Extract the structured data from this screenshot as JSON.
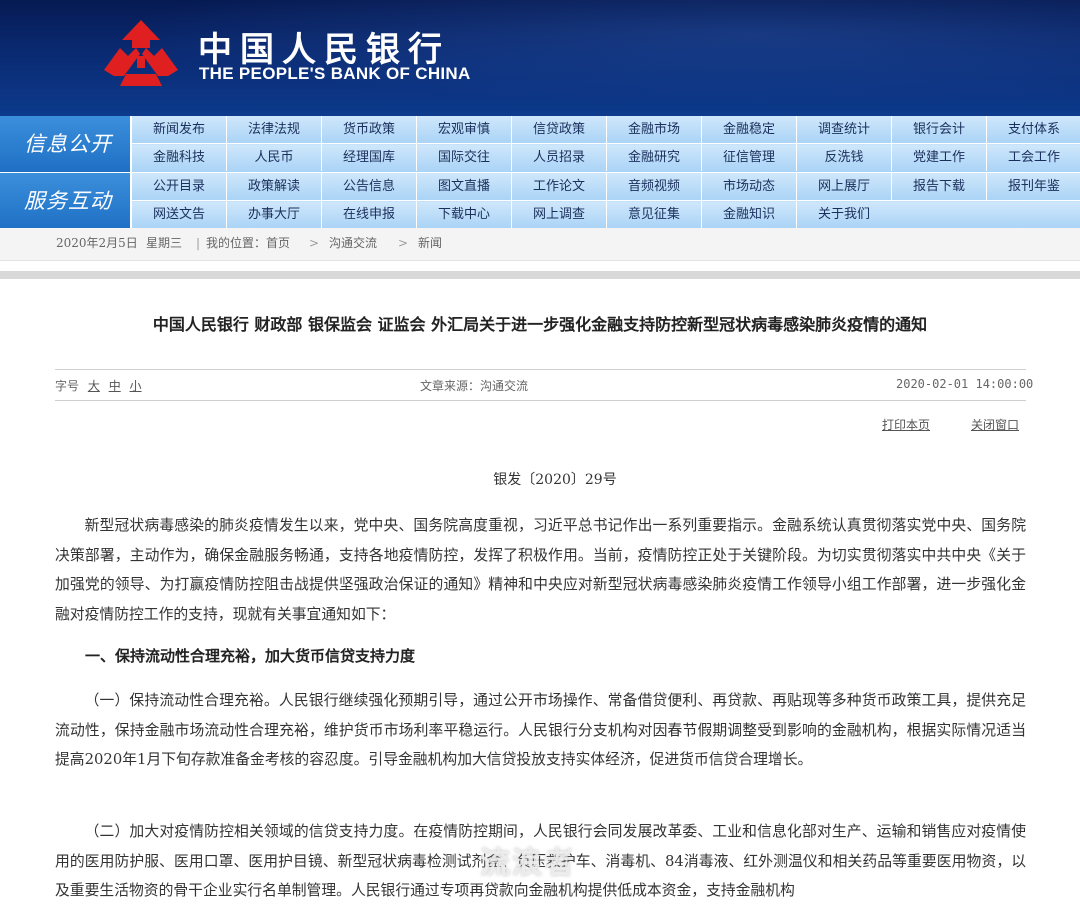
{
  "header": {
    "logo_cn": "中国人民银行",
    "logo_en": "THE PEOPLE'S BANK OF CHINA",
    "accent": "#0a2a72",
    "emblem_color": "#e02020"
  },
  "nav": {
    "section1_title": "信息公开",
    "section2_title": "服务互动",
    "row1_top": [
      "新闻发布",
      "法律法规",
      "货币政策",
      "宏观审慎",
      "信贷政策",
      "金融市场",
      "金融稳定",
      "调查统计",
      "银行会计",
      "支付体系"
    ],
    "row1_bottom": [
      "金融科技",
      "人民币",
      "经理国库",
      "国际交往",
      "人员招录",
      "金融研究",
      "征信管理",
      "反洗钱",
      "党建工作",
      "工会工作"
    ],
    "row2_top": [
      "公开目录",
      "政策解读",
      "公告信息",
      "图文直播",
      "工作论文",
      "音频视频",
      "市场动态",
      "网上展厅",
      "报告下载",
      "报刊年鉴"
    ],
    "row2_bottom": [
      "网送文告",
      "办事大厅",
      "在线申报",
      "下载中心",
      "网上调查",
      "意见征集",
      "金融知识",
      "关于我们"
    ]
  },
  "breadcrumb": {
    "date": "2020年2月5日",
    "weekday": "星期三",
    "location_label": "我的位置：首页",
    "sep": ">",
    "level1": "沟通交流",
    "level2": "新闻"
  },
  "article": {
    "title": "中国人民银行 财政部 银保监会 证监会 外汇局关于进一步强化金融支持防控新型冠状病毒感染肺炎疫情的通知",
    "font_size_label": "字号",
    "font_large": "大",
    "font_medium": "中",
    "font_small": "小",
    "source": "文章来源：沟通交流",
    "published": "2020-02-01 14:00:00",
    "print_label": "打印本页",
    "close_label": "关闭窗口",
    "doc_number": "银发〔2020〕29号",
    "para1": "新型冠状病毒感染的肺炎疫情发生以来，党中央、国务院高度重视，习近平总书记作出一系列重要指示。金融系统认真贯彻落实党中央、国务院决策部署，主动作为，确保金融服务畅通，支持各地疫情防控，发挥了积极作用。当前，疫情防控正处于关键阶段。为切实贯彻落实中共中央《关于加强党的领导、为打赢疫情防控阻击战提供坚强政治保证的通知》精神和中央应对新型冠状病毒感染肺炎疫情工作领导小组工作部署，进一步强化金融对疫情防控工作的支持，现就有关事宜通知如下：",
    "section1": "一、保持流动性合理充裕，加大货币信贷支持力度",
    "para2": "（一）保持流动性合理充裕。人民银行继续强化预期引导，通过公开市场操作、常备借贷便利、再贷款、再贴现等多种货币政策工具，提供充足流动性，保持金融市场流动性合理充裕，维护货币市场利率平稳运行。人民银行分支机构对因春节假期调整受到影响的金融机构，根据实际情况适当提高2020年1月下旬存款准备金考核的容忍度。引导金融机构加大信贷投放支持实体经济，促进货币信贷合理增长。",
    "para3": "（二）加大对疫情防控相关领域的信贷支持力度。在疫情防控期间，人民银行会同发展改革委、工业和信息化部对生产、运输和销售应对疫情使用的医用防护服、医用口罩、医用护目镜、新型冠状病毒检测试剂盒、负压救护车、消毒机、84消毒液、红外测温仪和相关药品等重要医用物资，以及重要生活物资的骨干企业实行名单制管理。人民银行通过专项再贷款向金融机构提供低成本资金，支持金融机构"
  },
  "watermark": "流浪者"
}
